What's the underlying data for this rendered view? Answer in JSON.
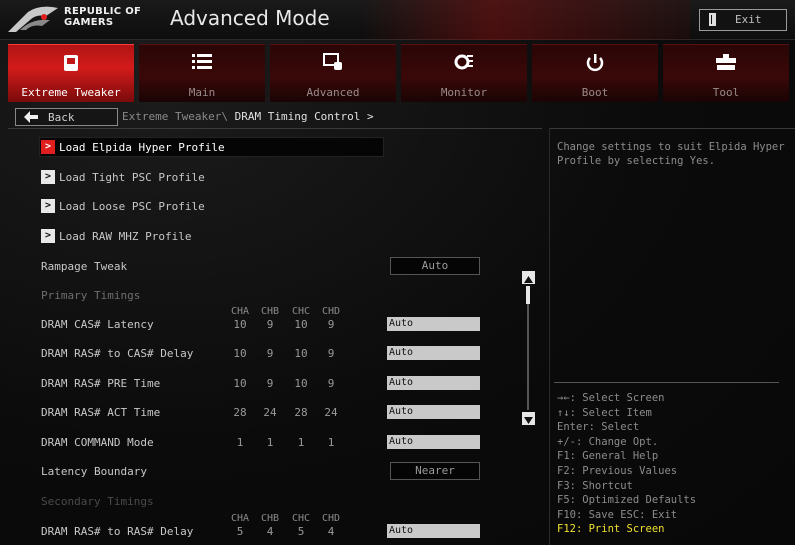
{
  "header": {
    "brand_line1": "REPUBLIC OF",
    "brand_line2": "GAMERS",
    "mode_title": "Advanced Mode",
    "exit_label": "Exit"
  },
  "tabs": [
    {
      "label": "Extreme Tweaker",
      "icon": "tweaker-icon",
      "active": true
    },
    {
      "label": "Main",
      "icon": "list-icon",
      "active": false
    },
    {
      "label": "Advanced",
      "icon": "advanced-icon",
      "active": false
    },
    {
      "label": "Monitor",
      "icon": "monitor-icon",
      "active": false
    },
    {
      "label": "Boot",
      "icon": "power-icon",
      "active": false
    },
    {
      "label": "Tool",
      "icon": "tool-icon",
      "active": false
    }
  ],
  "nav": {
    "back_label": "Back",
    "breadcrumb_path": "Extreme Tweaker\\",
    "breadcrumb_current": "DRAM Timing Control >"
  },
  "main": {
    "profiles": [
      {
        "label": "Load Elpida Hyper Profile",
        "selected": true
      },
      {
        "label": "Load Tight PSC Profile",
        "selected": false
      },
      {
        "label": "Load Loose PSC Profile",
        "selected": false
      },
      {
        "label": "Load RAW MHZ Profile",
        "selected": false
      }
    ],
    "rampage_tweak": {
      "label": "Rampage Tweak",
      "value": "Auto"
    },
    "primary_section": "Primary Timings",
    "channel_headers": [
      "CHA",
      "CHB",
      "CHC",
      "CHD"
    ],
    "primary_rows": [
      {
        "label": "DRAM CAS# Latency",
        "values": [
          "10",
          "9",
          "10",
          "9"
        ],
        "field": "Auto"
      },
      {
        "label": "DRAM RAS# to CAS# Delay",
        "values": [
          "10",
          "9",
          "10",
          "9"
        ],
        "field": "Auto"
      },
      {
        "label": "DRAM RAS# PRE Time",
        "values": [
          "10",
          "9",
          "10",
          "9"
        ],
        "field": "Auto"
      },
      {
        "label": "DRAM RAS# ACT Time",
        "values": [
          "28",
          "24",
          "28",
          "24"
        ],
        "field": "Auto"
      },
      {
        "label": "DRAM COMMAND Mode",
        "values": [
          "1",
          "1",
          "1",
          "1"
        ],
        "field": "Auto"
      }
    ],
    "latency_boundary": {
      "label": "Latency Boundary",
      "value": "Nearer"
    },
    "secondary_section": "Secondary Timings",
    "secondary_rows": [
      {
        "label": "DRAM RAS# to RAS# Delay",
        "values": [
          "5",
          "4",
          "5",
          "4"
        ],
        "field": "Auto"
      }
    ]
  },
  "help": {
    "description": "Change settings to suit Elpida Hyper Profile by selecting Yes.",
    "keys": [
      "→←: Select Screen",
      "↑↓: Select Item",
      "Enter: Select",
      "+/-: Change Opt.",
      "F1: General Help",
      "F2: Previous Values",
      "F3: Shortcut",
      "F5: Optimized Defaults",
      "F10: Save  ESC: Exit",
      "F12: Print Screen"
    ]
  },
  "colors": {
    "accent_red": "#d31b1b",
    "highlight_yellow": "#f0e030"
  }
}
